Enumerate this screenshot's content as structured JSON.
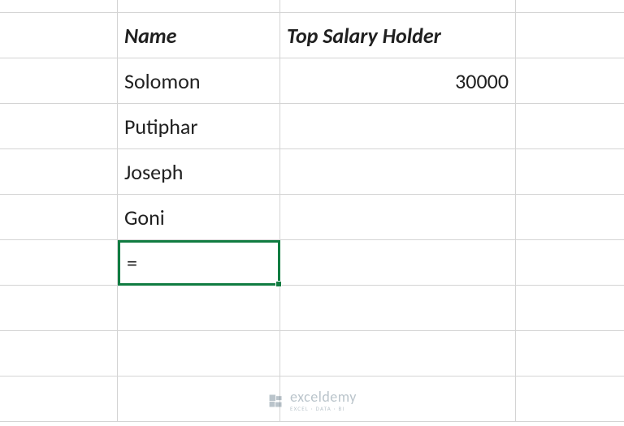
{
  "headers": {
    "name": "Name",
    "salary": "Top Salary Holder"
  },
  "rows": [
    {
      "name": "Solomon",
      "salary": "30000"
    },
    {
      "name": "Putiphar",
      "salary": ""
    },
    {
      "name": "Joseph",
      "salary": ""
    },
    {
      "name": "Goni",
      "salary": ""
    }
  ],
  "active_cell_value": "=",
  "watermark": {
    "brand": "exceldemy",
    "tagline": "EXCEL · DATA · BI"
  },
  "colors": {
    "grid_line": "#d4d4d4",
    "active_border": "#107c41",
    "text": "#202020",
    "watermark": "#3d5a6c"
  }
}
